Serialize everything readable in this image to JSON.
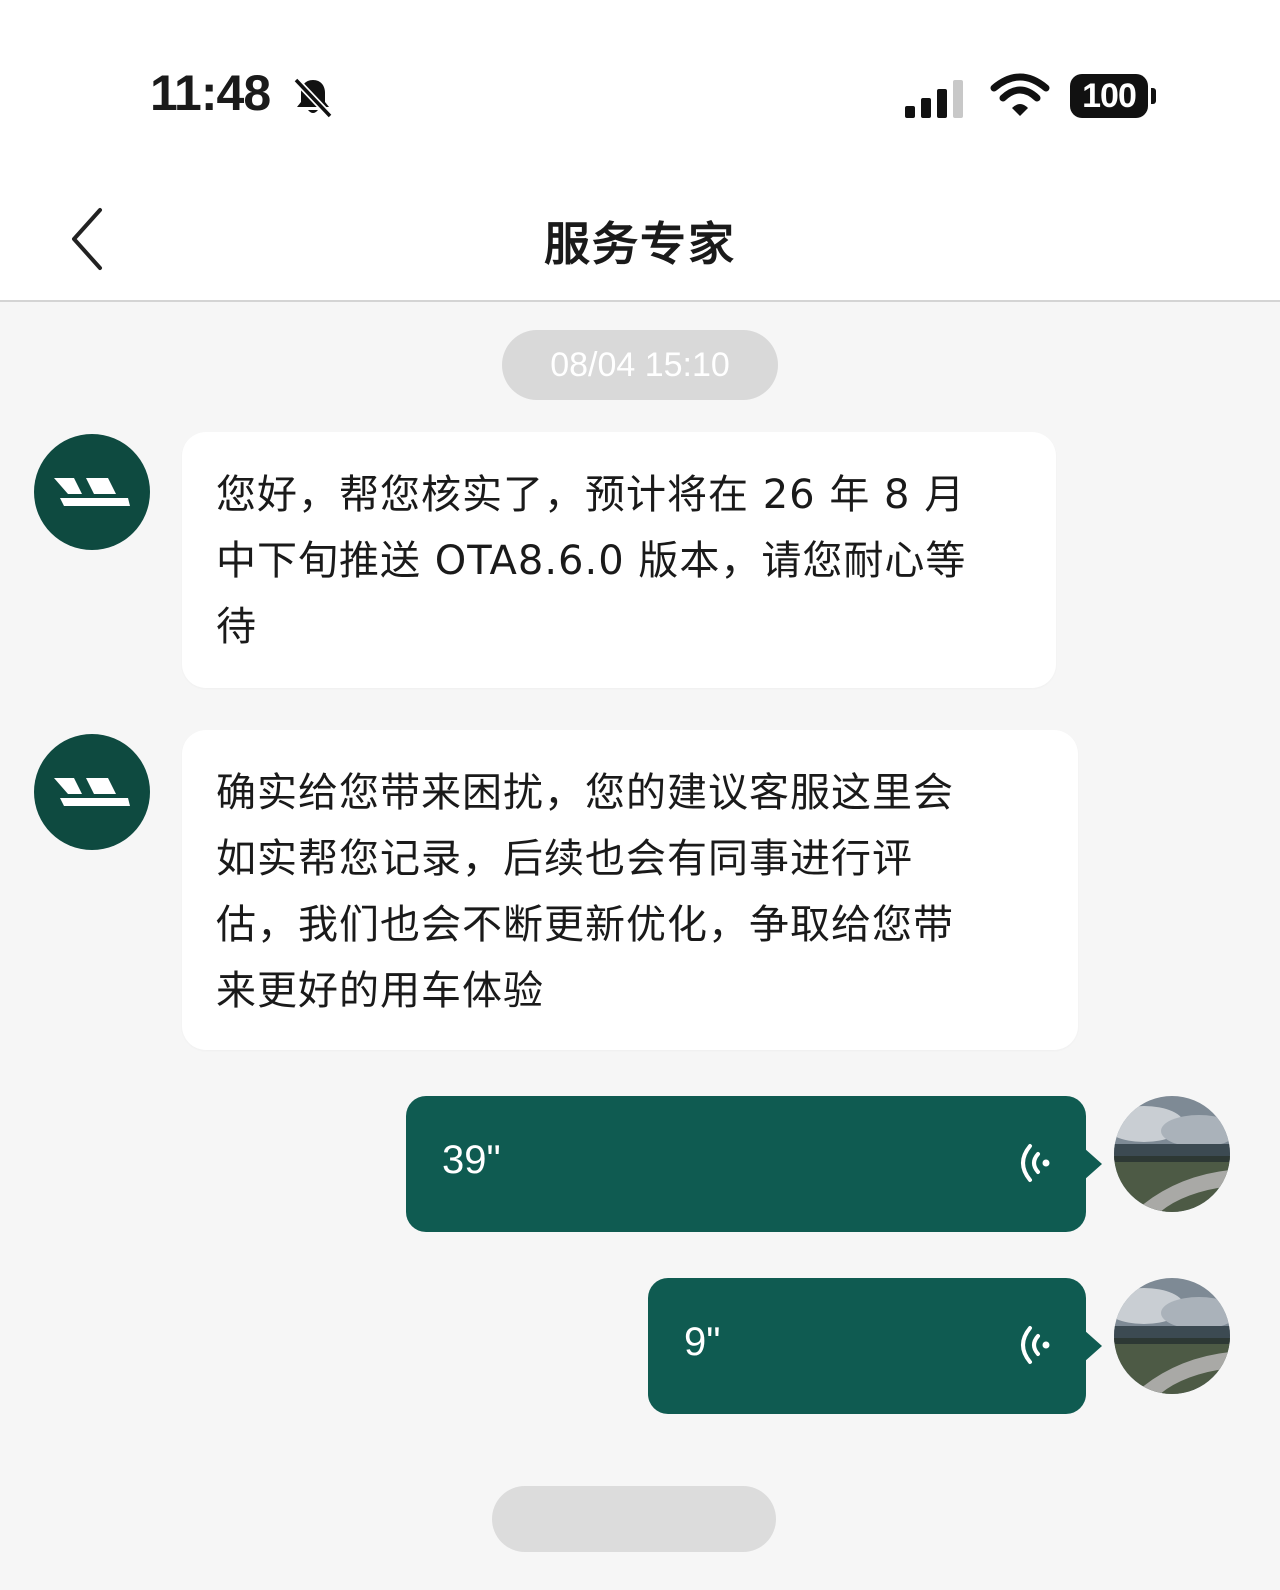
{
  "status_bar": {
    "time": "11:48",
    "battery": "100",
    "icons": [
      "bell-slash-icon",
      "cellular-signal-icon",
      "wifi-icon",
      "battery-icon"
    ]
  },
  "nav": {
    "title": "服务专家",
    "back_icon": "chevron-left-icon"
  },
  "chat": {
    "timestamp": "08/04 15:10",
    "messages": [
      {
        "from": "agent",
        "lines": [
          "您好，帮您核实了，预计将在 26 年 8 月",
          "中下旬推送 OTA8.6.0 版本，请您耐心等",
          "待"
        ]
      },
      {
        "from": "agent",
        "lines": [
          "确实给您带来困扰，您的建议客服这里会",
          "如实帮您记录，后续也会有同事进行评",
          "估，我们也会不断更新优化，争取给您带",
          "来更好的用车体验"
        ]
      },
      {
        "from": "user",
        "type": "voice",
        "duration": "39\""
      },
      {
        "from": "user",
        "type": "voice",
        "duration": "9\""
      }
    ]
  },
  "colors": {
    "agent_avatar": "#0e4a40",
    "voice_bubble": "#0f5b51",
    "background": "#f6f6f6"
  }
}
